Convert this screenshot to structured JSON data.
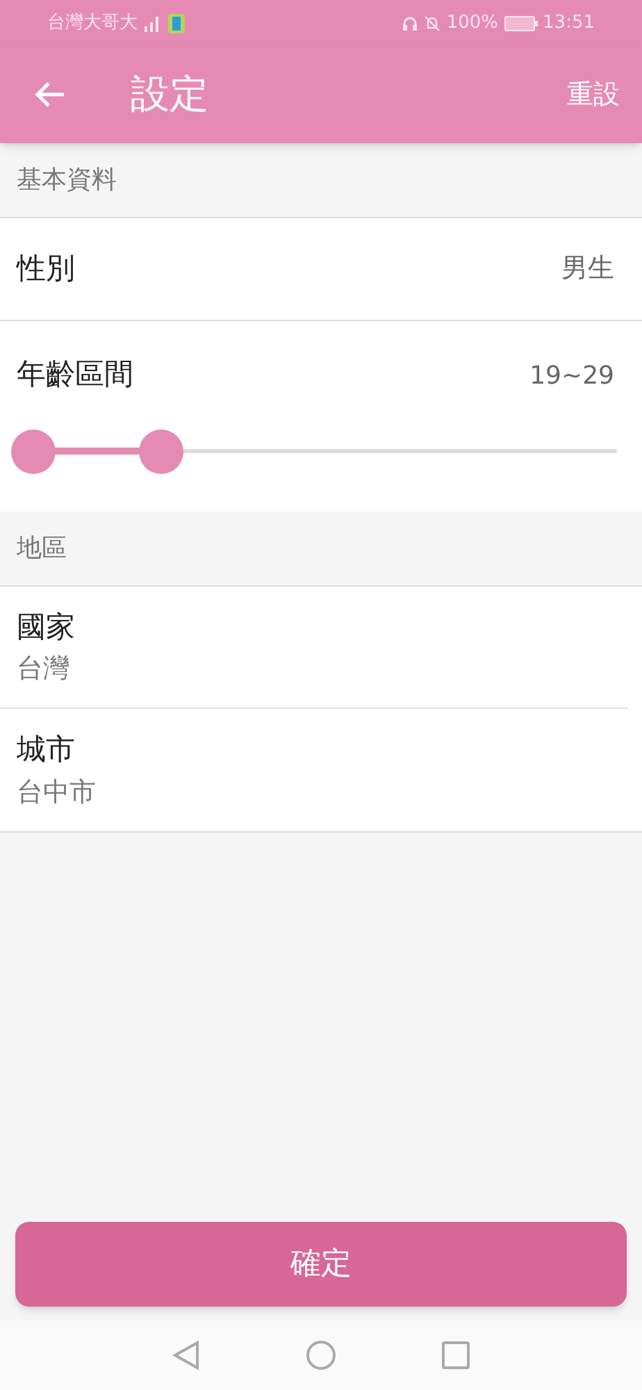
{
  "status_bar": {
    "carrier": "台灣大哥大",
    "battery": "100%",
    "time": "13:51"
  },
  "app_bar": {
    "title": "設定",
    "action": "重設"
  },
  "basic_section": {
    "header": "基本資料",
    "gender": {
      "label": "性別",
      "value": "男生"
    },
    "age": {
      "label": "年齡區間",
      "value": "19~29",
      "thumbs": [
        {
          "level": 0
        },
        {
          "level": 0.22
        }
      ]
    }
  },
  "region_section": {
    "header": "地區",
    "items": [
      {
        "label": "國家",
        "value": "台灣"
      },
      {
        "label": "城市",
        "value": "台中市"
      }
    ]
  },
  "confirm_button": "確定"
}
